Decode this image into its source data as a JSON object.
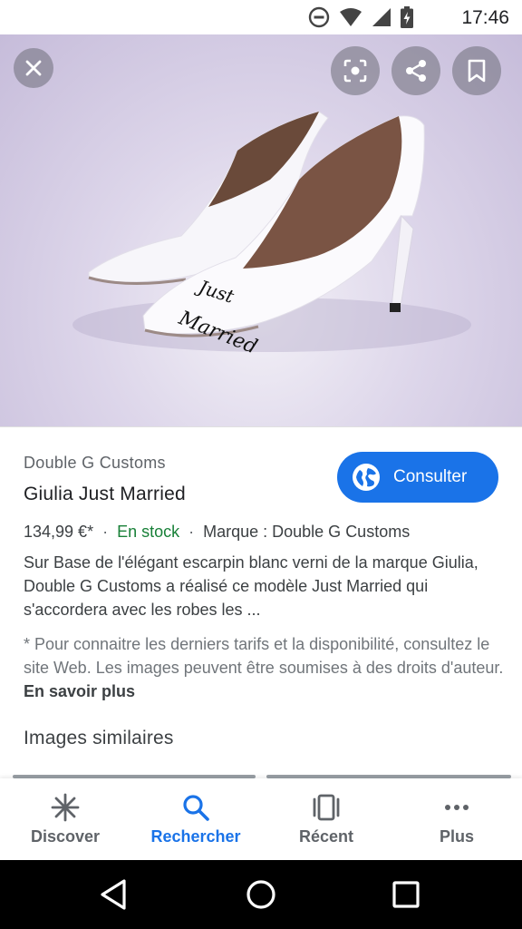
{
  "status_bar": {
    "time": "17:46",
    "icons": [
      "do-not-disturb-icon",
      "wifi-icon",
      "signal-icon",
      "battery-charging-icon"
    ]
  },
  "image_viewer": {
    "close_icon": "close-icon",
    "lens_icon": "lens-icon",
    "share_icon": "share-icon",
    "save_icon": "bookmark-icon",
    "shoe_text_line1": "Just",
    "shoe_text_line2": "Married"
  },
  "product": {
    "merchant": "Double G Customs",
    "title": "Giulia Just Married",
    "price": "134,99 €*",
    "stock": "En stock",
    "brand": "Marque : Double G Customs",
    "description": "Sur Base de l'élégant escarpin blanc verni de la marque Giulia, Double G Customs a réalisé ce modèle Just Married qui s'accordera avec les robes les ...",
    "note": "* Pour connaitre les derniers tarifs et la disponibilité, consultez le site Web. Les images peuvent être soumises à des droits d'auteur.",
    "note_link": "En savoir plus",
    "consult_button": "Consulter",
    "consult_icon": "globe-icon"
  },
  "similar": {
    "heading": "Images similaires"
  },
  "bottom_nav": {
    "items": [
      {
        "label": "Discover",
        "icon": "asterisk-icon",
        "active": false
      },
      {
        "label": "Rechercher",
        "icon": "search-icon",
        "active": true
      },
      {
        "label": "Récent",
        "icon": "recent-cards-icon",
        "active": false
      },
      {
        "label": "Plus",
        "icon": "more-dots-icon",
        "active": false
      }
    ]
  },
  "colors": {
    "accent": "#1a73e8",
    "stock_green": "#188038"
  }
}
